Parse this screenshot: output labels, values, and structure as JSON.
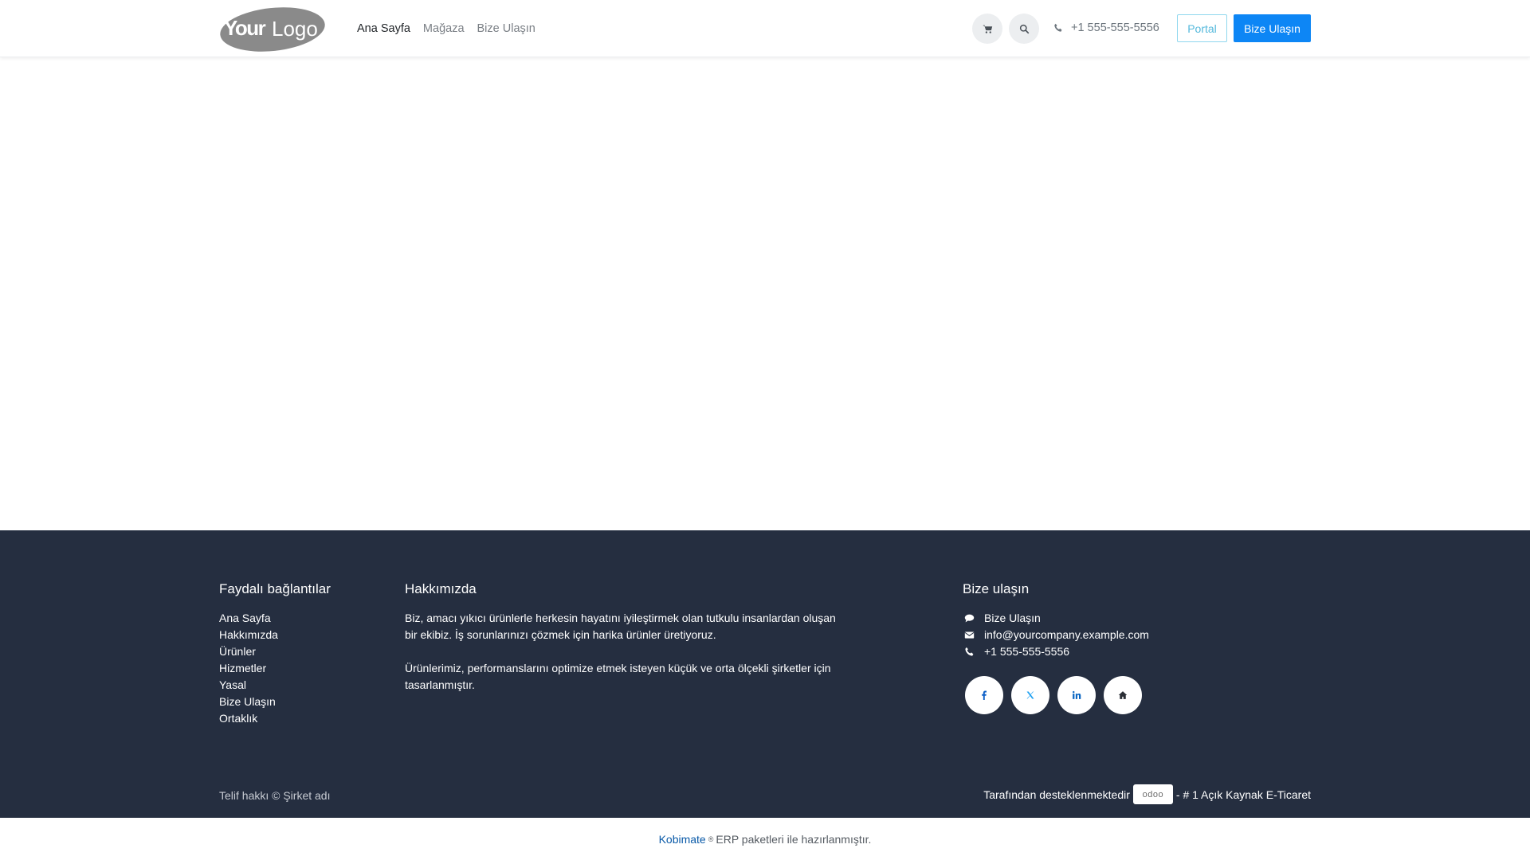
{
  "header": {
    "logo_text": "YourLogo",
    "nav": [
      {
        "label": "Ana Sayfa",
        "active": true
      },
      {
        "label": "Mağaza",
        "active": false
      },
      {
        "label": "Bize Ulaşın",
        "active": false
      }
    ],
    "cart_icon": "cart-icon",
    "search_icon": "search-icon",
    "phone": "+1 555-555-5556",
    "portal_label": "Portal",
    "contact_label": "Bize Ulaşın"
  },
  "footer": {
    "links_title": "Faydalı bağlantılar",
    "links": [
      "Ana Sayfa",
      "Hakkımızda",
      "Ürünler",
      "Hizmetler",
      "Yasal",
      "Bize Ulaşın",
      "Ortaklık"
    ],
    "about_title": "Hakkımızda",
    "about_p1": "Biz, amacı yıkıcı ürünlerle herkesin hayatını iyileştirmek olan tutkulu insanlardan oluşan bir ekibiz. İş sorunlarınızı çözmek için harika ürünler üretiyoruz.",
    "about_p2": "Ürünlerimiz, performanslarını optimize etmek isteyen küçük ve orta ölçekli şirketler için tasarlanmıştır.",
    "contact_title": "Bize ulaşın",
    "contact_items": [
      {
        "icon": "comment-icon",
        "text": "Bize Ulaşın"
      },
      {
        "icon": "envelope-icon",
        "text": "info@yourcompany.example.com"
      },
      {
        "icon": "phone-icon",
        "text": "+1 555-555-5556"
      }
    ],
    "socials": [
      "facebook-icon",
      "x-twitter-icon",
      "linkedin-icon",
      "home-icon"
    ],
    "copyright": "Telif hakkı © Şirket adı",
    "powered_prefix": "Tarafından desteklenmektedir",
    "powered_badge": "odoo",
    "powered_suffix": "- # 1 Açık Kaynak E-Ticaret"
  },
  "bottom": {
    "brand": "Kobimate",
    "reg": "®",
    "text": "ERP paketleri ile hazırlanmıştır."
  },
  "colors": {
    "footer_bg": "#252e40",
    "primary": "#0d86f5",
    "portal_border": "#8fd7ee"
  }
}
